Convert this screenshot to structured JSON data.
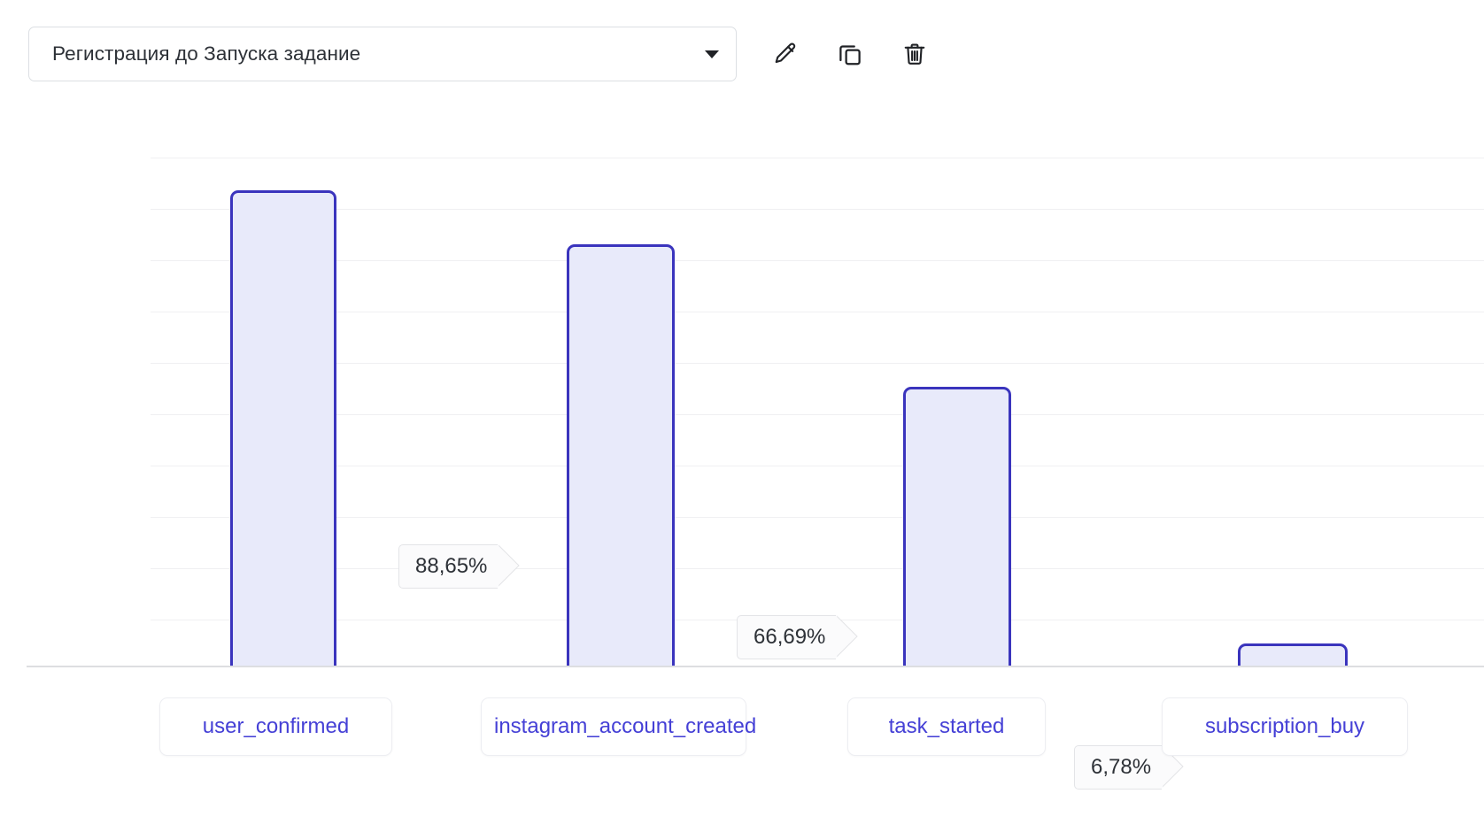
{
  "toolbar": {
    "funnel_select": {
      "value": "Регистрация до Запуска задание",
      "icon": "chevron-down-icon"
    },
    "actions": [
      {
        "name": "edit-funnel-button",
        "icon": "pencil-icon",
        "label": "Edit"
      },
      {
        "name": "duplicate-funnel-button",
        "icon": "copy-icon",
        "label": "Duplicate"
      },
      {
        "name": "delete-funnel-button",
        "icon": "trash-icon",
        "label": "Delete"
      }
    ]
  },
  "colors": {
    "bar_fill": "#e8eafa",
    "bar_border": "#3a34bd",
    "label_text": "#4540d6",
    "gridline": "#f0f0f2",
    "baseline": "#dddee1",
    "badge_bg": "#fbfbfc",
    "badge_border": "#e3e4e7"
  },
  "chart_data": {
    "type": "bar",
    "title": "",
    "xlabel": "",
    "ylabel": "",
    "grid": true,
    "legend": "none",
    "ylim": [
      0,
      100
    ],
    "categories": [
      "user_confirmed",
      "instagram_account_created",
      "task_started",
      "subscription_buy"
    ],
    "values": [
      100,
      88.65,
      66.69,
      6.78
    ],
    "value_unit": "%",
    "conversion_labels": [
      "88,65%",
      "66,69%",
      "6,78%"
    ],
    "conversion_between": [
      "user_confirmed -> instagram_account_created",
      "instagram_account_created -> task_started",
      "task_started -> subscription_buy"
    ],
    "gridline_count": 10
  }
}
